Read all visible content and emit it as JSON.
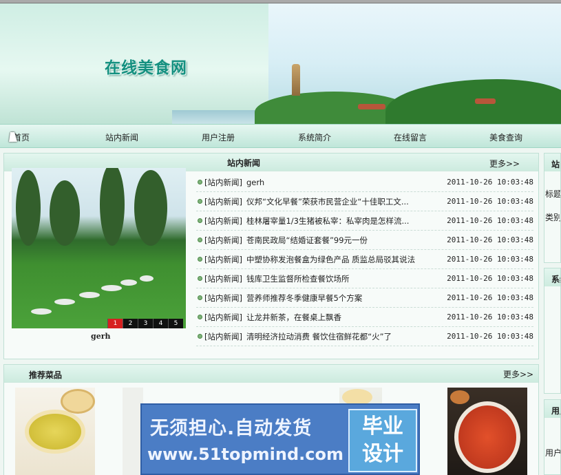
{
  "site": {
    "title": "在线美食网"
  },
  "nav": {
    "items": [
      "首页",
      "站内新闻",
      "用户注册",
      "系统简介",
      "在线留言",
      "美食查询"
    ]
  },
  "news": {
    "title": "站内新闻",
    "more": "更多>>",
    "photo_caption": "gerh",
    "pager": [
      "1",
      "2",
      "3",
      "4",
      "5"
    ],
    "pager_active": "1",
    "items": [
      {
        "category": "[站内新闻]",
        "title": "gerh",
        "date": "2011-10-26 10:03:48"
      },
      {
        "category": "[站内新闻]",
        "title": "仪邦“文化早餐”荣获市民营企业“十佳职工文...",
        "date": "2011-10-26 10:03:48"
      },
      {
        "category": "[站内新闻]",
        "title": "桂林屠宰量1/3生猪被私宰：私宰肉是怎样流...",
        "date": "2011-10-26 10:03:48"
      },
      {
        "category": "[站内新闻]",
        "title": "苍南民政局“结婚证套餐”99元一份",
        "date": "2011-10-26 10:03:48"
      },
      {
        "category": "[站内新闻]",
        "title": "中塑协称发泡餐盒为绿色产品 质监总局驳其说法",
        "date": "2011-10-26 10:03:48"
      },
      {
        "category": "[站内新闻]",
        "title": "钱库卫生监督所检查餐饮场所",
        "date": "2011-10-26 10:03:48"
      },
      {
        "category": "[站内新闻]",
        "title": "营养师推荐冬季健康早餐5个方案",
        "date": "2011-10-26 10:03:48"
      },
      {
        "category": "[站内新闻]",
        "title": "让龙井新茶，在餐桌上飘香",
        "date": "2011-10-26 10:03:48"
      },
      {
        "category": "[站内新闻]",
        "title": "清明经济拉动消费 餐饮住宿鲜花都“火”了",
        "date": "2011-10-26 10:03:48"
      }
    ]
  },
  "recommend": {
    "title": "推荐菜品",
    "more": "更多>>"
  },
  "side": {
    "panel1_head": "站内",
    "panel1_line1": "标题",
    "panel1_line2": "类别",
    "panel2_head": "系统",
    "panel3_head": "用户",
    "panel3_line1": "用户"
  },
  "ad": {
    "line1": "无须担心.自动发货",
    "line2": "www.51topmind.com",
    "badge_top": "毕业",
    "badge_bottom": "设计"
  },
  "colors": {
    "brand": "#159080",
    "accent_red": "#d72020",
    "panel_border": "#bfe0d4",
    "ad_blue": "#4b7dc5"
  }
}
